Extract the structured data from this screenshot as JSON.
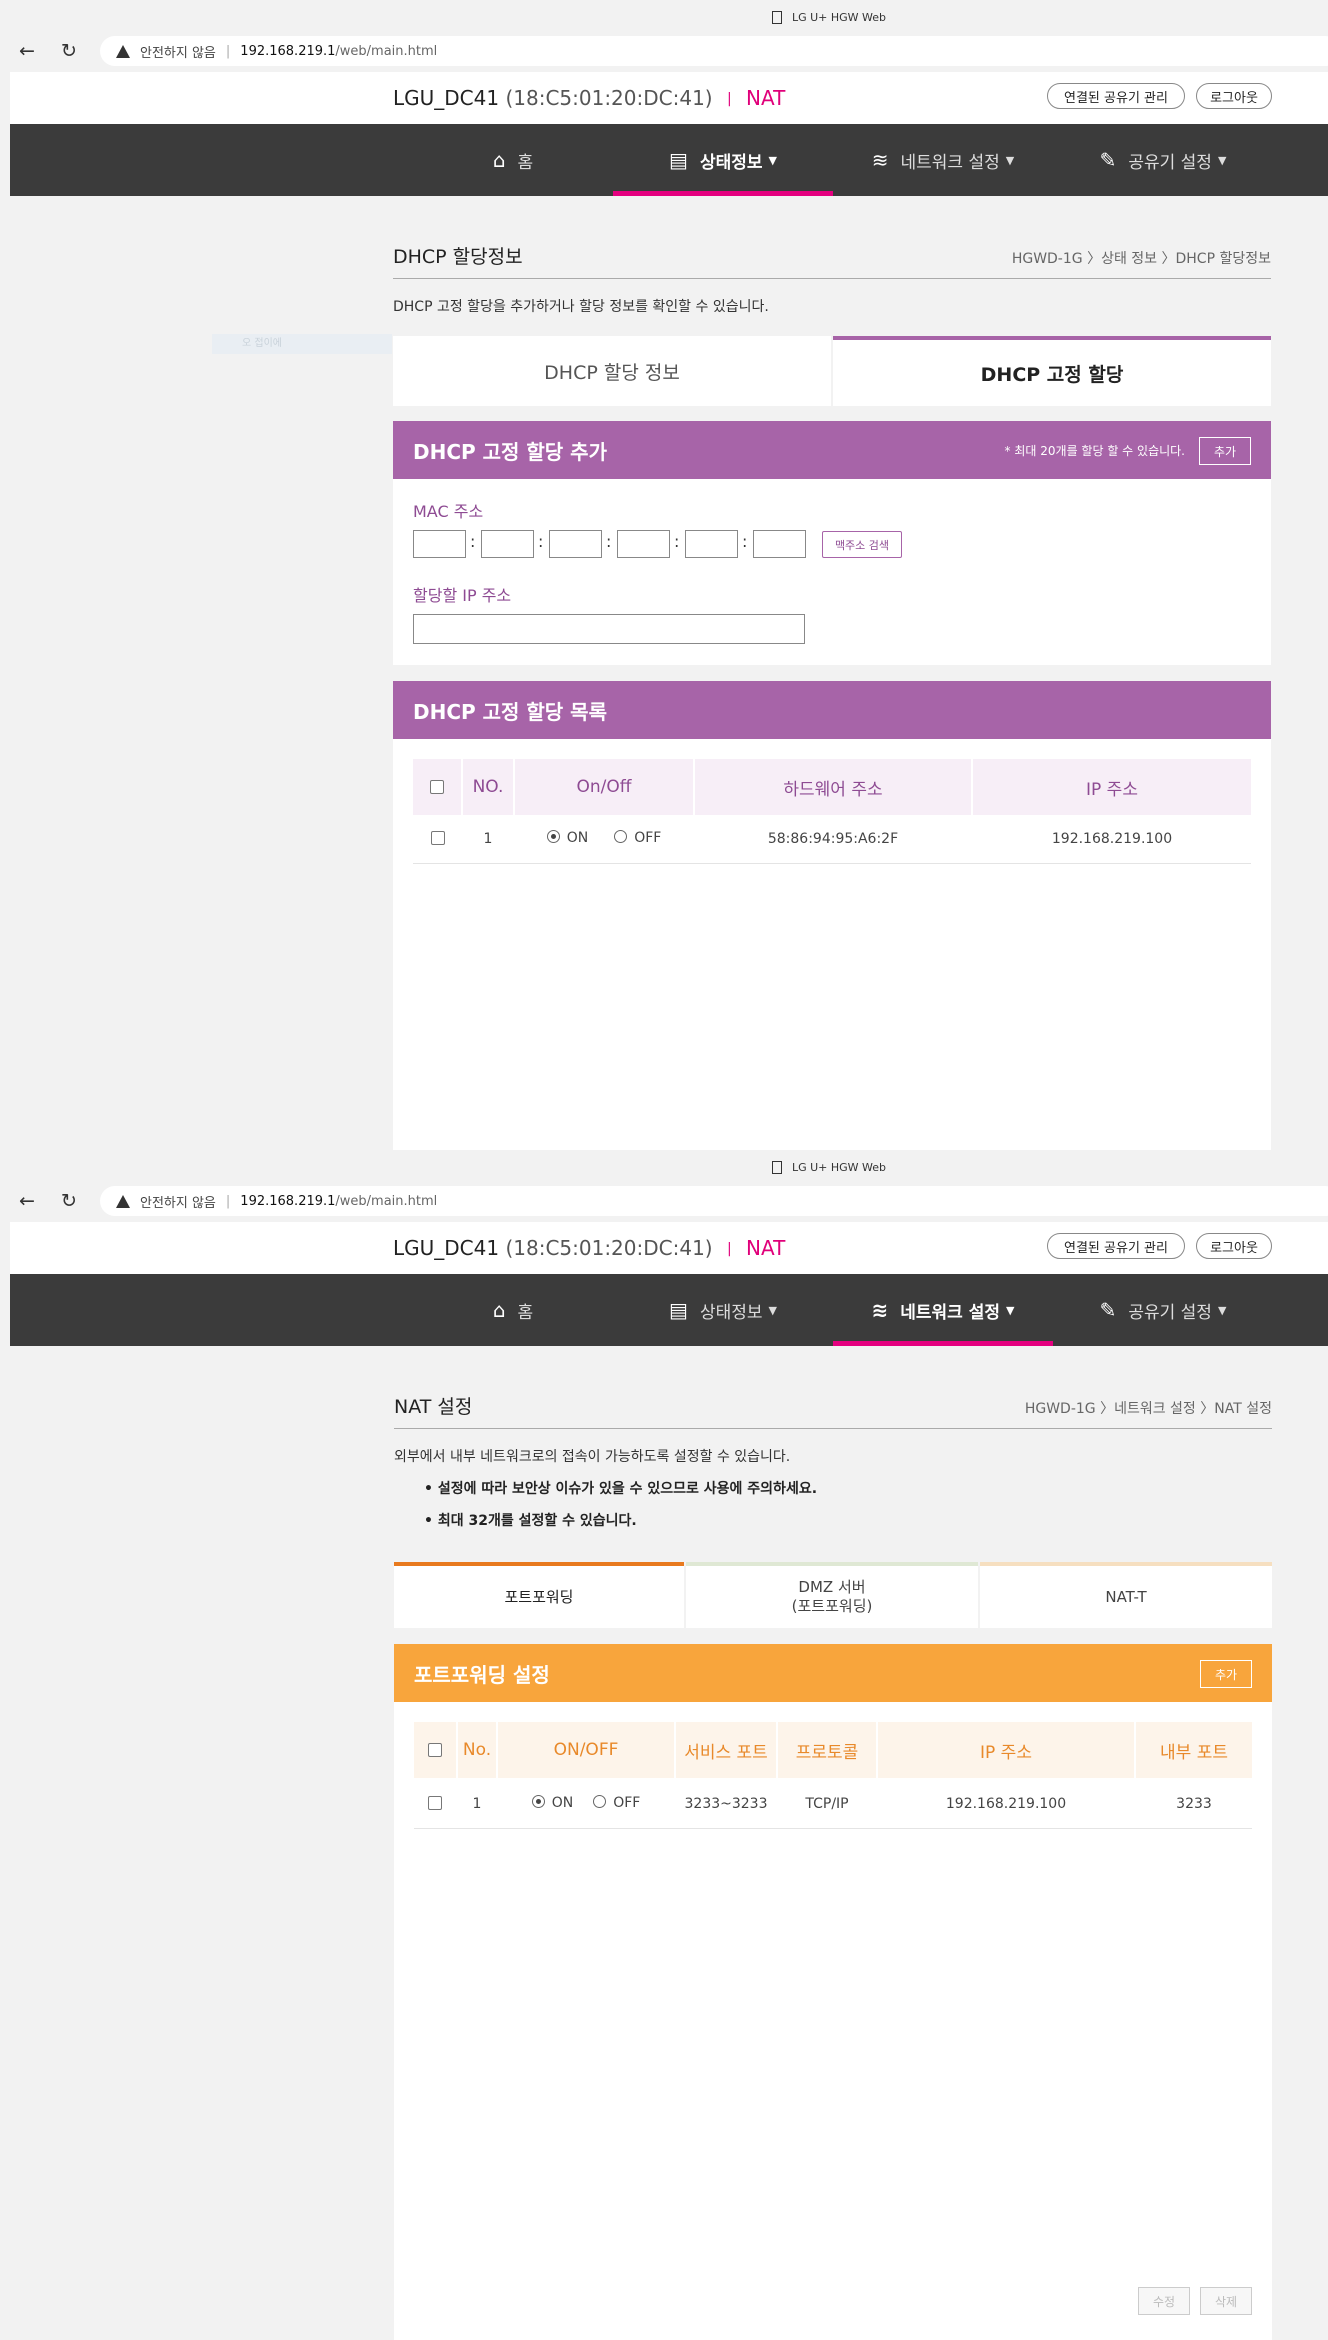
{
  "screens": [
    {
      "window_title": "LG U+ HGW Web",
      "address": {
        "security": "안전하지 않음",
        "host": "192.168.219.1",
        "path": "/web/main.html"
      },
      "header": {
        "ssid": "LGU_DC41",
        "mac": "(18:C5:01:20:DC:41)",
        "separator": "|",
        "mode": "NAT",
        "btn_devices": "연결된 공유기 관리",
        "btn_logout": "로그아웃"
      },
      "menu": [
        {
          "label": "홈"
        },
        {
          "label": "상태정보"
        },
        {
          "label": "네트워크 설정"
        },
        {
          "label": "공유기 설정"
        }
      ],
      "page": {
        "title": "DHCP 할당정보",
        "breadcrumb": "HGWD-1G 〉상태 정보 〉DHCP 할당정보",
        "description": "DHCP 고정 할당을 추가하거나 할당 정보를 확인할 수 있습니다.",
        "side_text": "오 접이에",
        "tabs": [
          {
            "label": "DHCP 할당 정보"
          },
          {
            "label": "DHCP 고정 할당"
          }
        ],
        "add_section": {
          "title": "DHCP 고정 할당 추가",
          "note": "* 최대 20개를 할당 할 수 있습니다.",
          "add_button": "추가",
          "mac_label": "MAC 주소",
          "mac_search_button": "맥주소 검색",
          "ip_label": "할당할 IP 주소",
          "ip_value": ""
        },
        "list_section": {
          "title": "DHCP 고정 할당 목록",
          "columns": [
            "NO.",
            "On/Off",
            "하드웨어 주소",
            "IP 주소"
          ],
          "rows": [
            {
              "no": "1",
              "on": "ON",
              "off": "OFF",
              "state": "on",
              "mac": "58:86:94:95:A6:2F",
              "ip": "192.168.219.100"
            }
          ]
        }
      }
    },
    {
      "window_title": "LG U+ HGW Web",
      "address": {
        "security": "안전하지 않음",
        "host": "192.168.219.1",
        "path": "/web/main.html"
      },
      "header": {
        "ssid": "LGU_DC41",
        "mac": "(18:C5:01:20:DC:41)",
        "separator": "|",
        "mode": "NAT",
        "btn_devices": "연결된 공유기 관리",
        "btn_logout": "로그아웃"
      },
      "menu": [
        {
          "label": "홈"
        },
        {
          "label": "상태정보"
        },
        {
          "label": "네트워크 설정"
        },
        {
          "label": "공유기 설정"
        }
      ],
      "page": {
        "title": "NAT 설정",
        "breadcrumb": "HGWD-1G 〉네트워크 설정 〉NAT 설정",
        "description": "외부에서 내부 네트워크로의 접속이 가능하도록 설정할 수 있습니다.",
        "bullets": [
          "설정에 따라 보안상 이슈가 있을 수 있으므로 사용에 주의하세요.",
          "최대 32개를 설정할 수 있습니다."
        ],
        "tabs": [
          {
            "label": "포트포워딩"
          },
          {
            "label": "DMZ 서버",
            "sub": "(포트포워딩)"
          },
          {
            "label": "NAT-T"
          }
        ],
        "section": {
          "title": "포트포워딩 설정",
          "add_button": "추가",
          "columns": [
            "No.",
            "ON/OFF",
            "서비스 포트",
            "프로토콜",
            "IP 주소",
            "내부 포트"
          ],
          "rows": [
            {
              "no": "1",
              "on": "ON",
              "off": "OFF",
              "state": "on",
              "service_port": "3233~3233",
              "protocol": "TCP/IP",
              "ip": "192.168.219.100",
              "inner_port": "3233"
            }
          ]
        },
        "bottom_buttons": {
          "edit": "수정",
          "delete": "삭제"
        }
      }
    }
  ],
  "colors": {
    "menu_bg": "#3b3b3b",
    "menu_active": "#e4007f",
    "purple": "#a764a8",
    "orange": "#f8a53c",
    "nat_pink": "#e0007a"
  },
  "icons": {
    "home": "home-icon",
    "status": "document-icon",
    "network": "wifi-icon",
    "settings": "wrench-icon"
  }
}
